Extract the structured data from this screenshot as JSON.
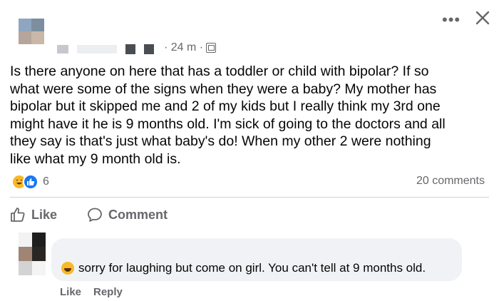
{
  "post": {
    "meta_time": "· 24 m ·",
    "text": "Is there anyone on here that has a toddler or child with bipolar? If so\nwhat were some of the signs when they were a baby? My mother has\nbipolar but it skipped me and 2 of my kids but I really think my 3rd one\nmight have it he is 9 months old. I'm sick of going to the doctors and all\nthey say is that's just what baby's do! When my other 2 were nothing\nlike what my 9 month old is.",
    "reaction_count": "6",
    "comments_count": "20 comments",
    "reactions": [
      "haha-icon",
      "like-icon"
    ]
  },
  "actions": {
    "like_label": "Like",
    "comment_label": "Comment"
  },
  "comment": {
    "text": "sorry for laughing but come on girl. You can't tell at 9 months old.",
    "like_label": "Like",
    "reply_label": "Reply"
  },
  "colors": {
    "secondary_text": "#65676b",
    "bubble": "#f0f2f5",
    "like_blue": "#1877f2",
    "haha_yellow": "#f7b928"
  }
}
